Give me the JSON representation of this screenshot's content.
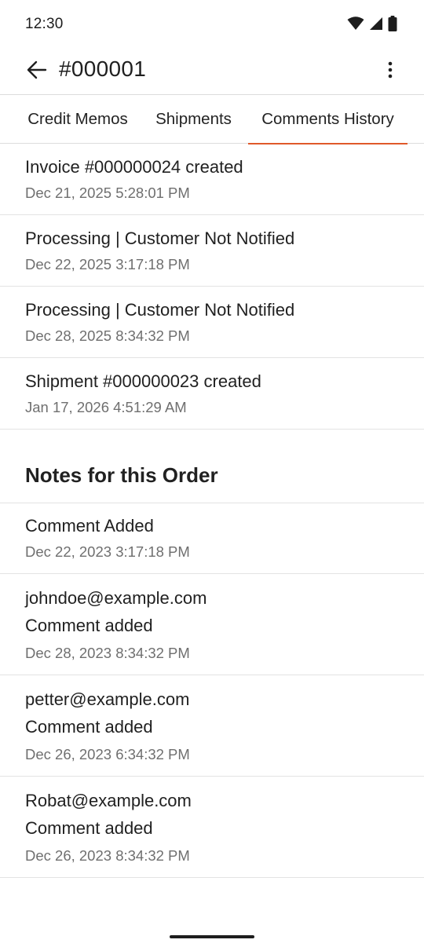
{
  "status_bar": {
    "time": "12:30",
    "icons": [
      "wifi-icon",
      "signal-icon",
      "battery-icon"
    ]
  },
  "app_bar": {
    "title": "#000001",
    "back_icon": "arrow-left-icon",
    "menu_icon": "more-vert-icon"
  },
  "tabs": [
    {
      "label": "Credit Memos",
      "active": false
    },
    {
      "label": "Shipments",
      "active": false
    },
    {
      "label": "Comments History",
      "active": true
    }
  ],
  "history": [
    {
      "title": "Invoice #000000024 created",
      "date": "Dec 21, 2025 5:28:01 PM"
    },
    {
      "title": "Processing | Customer Not Notified",
      "date": "Dec 22, 2025 3:17:18 PM"
    },
    {
      "title": "Processing | Customer Not Notified",
      "date": "Dec 28, 2025 8:34:32 PM"
    },
    {
      "title": "Shipment #000000023 created",
      "date": "Jan 17, 2026 4:51:29 AM"
    }
  ],
  "notes": {
    "heading": "Notes for this Order",
    "items": [
      {
        "author": "",
        "comment": "Comment Added",
        "date": "Dec 22, 2023 3:17:18 PM"
      },
      {
        "author": "johndoe@example.com",
        "comment": "Comment added",
        "date": "Dec 28, 2023 8:34:32 PM"
      },
      {
        "author": "petter@example.com",
        "comment": "Comment added",
        "date": "Dec 26, 2023 6:34:32 PM"
      },
      {
        "author": "Robat@example.com",
        "comment": "Comment added",
        "date": "Dec 26, 2023 8:34:32 PM"
      }
    ]
  },
  "colors": {
    "accent": "#e0592a",
    "divider": "#e3e3e3",
    "secondary_text": "#6f6f6f"
  }
}
